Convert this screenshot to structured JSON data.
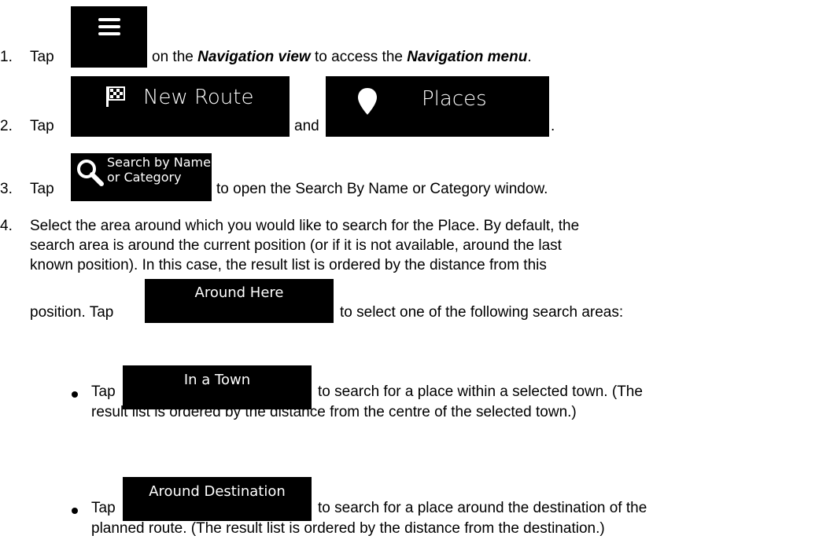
{
  "step1": {
    "num": "1.",
    "pre": "Tap",
    "mid": "on the",
    "view": "Navigation view",
    "mid2": "to access the",
    "menu": "Navigation menu",
    "end": "."
  },
  "step2": {
    "num": "2.",
    "pre": "Tap",
    "new_route": "New Route",
    "and": "and",
    "places": "Places",
    "end": "."
  },
  "step3": {
    "num": "3.",
    "pre": "Tap",
    "search_line1": "Search by Name",
    "search_line2": "or Category",
    "post": "to open the Search By Name or Category window."
  },
  "step4": {
    "num": "4.",
    "line1": "Select the area around which you would like to search for the Place. By default, the",
    "line2": "search area is around the current position (or if it is not available, around the last",
    "line3": "known position). In this case, the result list is ordered by the distance from this",
    "pre": "position. Tap",
    "around_here": "Around Here",
    "post": "to select one of the following search areas:"
  },
  "bullet1": {
    "pre": "Tap",
    "btn": "In a Town",
    "post": "to search for a place within a selected town. (The",
    "line2": "result list is ordered by the distance from the centre of the selected town.)"
  },
  "bullet2": {
    "pre": "Tap",
    "btn": "Around Destination",
    "post": "to search for a place around the destination of the",
    "line2": "planned route. (The result list is ordered by the distance from the destination.)"
  }
}
